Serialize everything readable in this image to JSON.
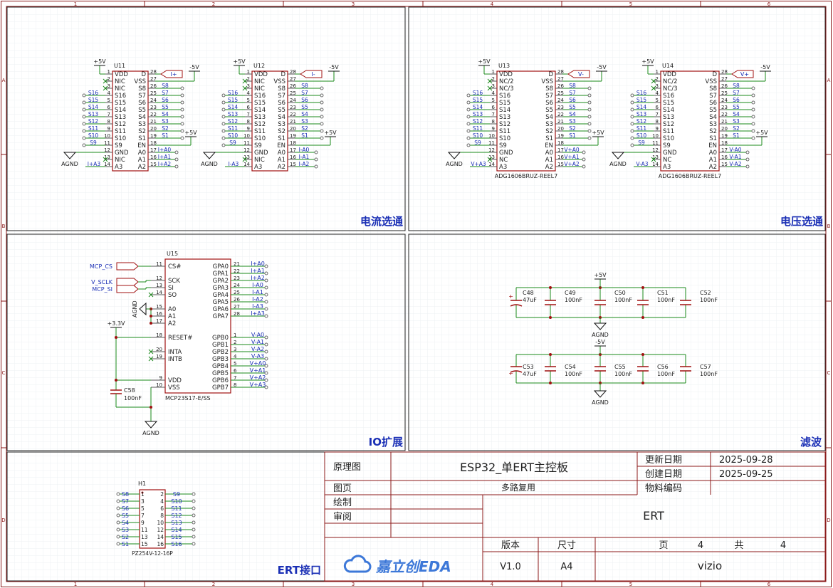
{
  "sheet": {
    "columns": [
      "1",
      "2",
      "3",
      "4",
      "5",
      "6"
    ],
    "rows": [
      "A",
      "B",
      "C",
      "D"
    ],
    "colors": {
      "wire": "#1a8a1a",
      "part": "#a01010",
      "net": "#1a2fb5",
      "border": "#8b1a1a",
      "pin": "#3a3a3a"
    }
  },
  "sections": {
    "current_mux": "电流选通",
    "voltage_mux": "电压选通",
    "io_expand": "IO扩展",
    "filter": "滤波",
    "ert_port": "ERT接口"
  },
  "mux": {
    "u11": {
      "ref": "U11",
      "part": "",
      "top_pwr": "+5V",
      "neg_pwr": "-5V",
      "en_pwr": "+5V",
      "gnd": "AGND",
      "d_net": "I+",
      "a3_net": "I+A3",
      "addr_nets": [
        "I+A0",
        "I+A1",
        "I+A2"
      ],
      "left_pins": [
        [
          "VDD",
          "1"
        ],
        [
          "NIC",
          "2"
        ],
        [
          "NIC",
          "3"
        ],
        [
          "S16",
          "4"
        ],
        [
          "S15",
          "5"
        ],
        [
          "S14",
          "6"
        ],
        [
          "S13",
          "7"
        ],
        [
          "S12",
          "8"
        ],
        [
          "S11",
          "9"
        ],
        [
          "S10",
          "10"
        ],
        [
          "S9",
          "11"
        ],
        [
          "GND",
          "12"
        ],
        [
          "NIC",
          "13"
        ],
        [
          "A3",
          "14"
        ]
      ],
      "right_pins": [
        [
          "D",
          "28"
        ],
        [
          "VSS",
          "27"
        ],
        [
          "S8",
          "26"
        ],
        [
          "S7",
          "25"
        ],
        [
          "S6",
          "24"
        ],
        [
          "S5",
          "23"
        ],
        [
          "S4",
          "22"
        ],
        [
          "S3",
          "21"
        ],
        [
          "S2",
          "20"
        ],
        [
          "S1",
          "19"
        ],
        [
          "EN",
          "18"
        ],
        [
          "A0",
          "17"
        ],
        [
          "A1",
          "16"
        ],
        [
          "A2",
          "15"
        ]
      ]
    },
    "u12": {
      "ref": "U12",
      "part": "",
      "top_pwr": "+5V",
      "neg_pwr": "-5V",
      "en_pwr": "+5V",
      "gnd": "AGND",
      "d_net": "I-",
      "a3_net": "I-A3",
      "addr_nets": [
        "I-A0",
        "I-A1",
        "I-A2"
      ],
      "left_pins": [
        [
          "VDD",
          "1"
        ],
        [
          "NIC",
          "2"
        ],
        [
          "NIC",
          "3"
        ],
        [
          "S16",
          "4"
        ],
        [
          "S15",
          "5"
        ],
        [
          "S14",
          "6"
        ],
        [
          "S13",
          "7"
        ],
        [
          "S12",
          "8"
        ],
        [
          "S11",
          "9"
        ],
        [
          "S10",
          "10"
        ],
        [
          "S9",
          "11"
        ],
        [
          "GND",
          "12"
        ],
        [
          "NIC",
          "13"
        ],
        [
          "A3",
          "14"
        ]
      ],
      "right_pins": [
        [
          "D",
          "28"
        ],
        [
          "VSS",
          "27"
        ],
        [
          "S8",
          "26"
        ],
        [
          "S7",
          "25"
        ],
        [
          "S6",
          "24"
        ],
        [
          "S5",
          "23"
        ],
        [
          "S4",
          "22"
        ],
        [
          "S3",
          "21"
        ],
        [
          "S2",
          "20"
        ],
        [
          "S1",
          "19"
        ],
        [
          "EN",
          "18"
        ],
        [
          "A0",
          "17"
        ],
        [
          "A1",
          "16"
        ],
        [
          "A2",
          "15"
        ]
      ]
    },
    "u13": {
      "ref": "U13",
      "part": "ADG1606BRUZ-REEL7",
      "top_pwr": "+5V",
      "neg_pwr": "-5V",
      "en_pwr": "+5V",
      "gnd": "AGND",
      "d_net": "V-",
      "a3_net": "V+A3",
      "addr_nets": [
        "V+A0",
        "V+A1",
        "V+A2"
      ],
      "left_pins": [
        [
          "VDD",
          "1"
        ],
        [
          "NC/2",
          "2"
        ],
        [
          "NC/3",
          "3"
        ],
        [
          "S16",
          "4"
        ],
        [
          "S15",
          "5"
        ],
        [
          "S14",
          "6"
        ],
        [
          "S13",
          "7"
        ],
        [
          "S12",
          "8"
        ],
        [
          "S11",
          "9"
        ],
        [
          "S10",
          "10"
        ],
        [
          "S9",
          "11"
        ],
        [
          "GND",
          "12"
        ],
        [
          "NC",
          "13"
        ],
        [
          "A3",
          "14"
        ]
      ],
      "right_pins": [
        [
          "D",
          "28"
        ],
        [
          "VSS",
          "27"
        ],
        [
          "S8",
          "26"
        ],
        [
          "S7",
          "25"
        ],
        [
          "S6",
          "24"
        ],
        [
          "S5",
          "23"
        ],
        [
          "S4",
          "22"
        ],
        [
          "S3",
          "21"
        ],
        [
          "S2",
          "20"
        ],
        [
          "S1",
          "19"
        ],
        [
          "EN",
          "18"
        ],
        [
          "A0",
          "17"
        ],
        [
          "A1",
          "16"
        ],
        [
          "A2",
          "15"
        ]
      ]
    },
    "u14": {
      "ref": "U14",
      "part": "ADG1606BRUZ-REEL7",
      "top_pwr": "+5V",
      "neg_pwr": "-5V",
      "en_pwr": "+5V",
      "gnd": "AGND",
      "d_net": "V+",
      "a3_net": "V-A3",
      "addr_nets": [
        "V-A0",
        "V-A1",
        "V-A2"
      ],
      "left_pins": [
        [
          "VDD",
          "1"
        ],
        [
          "NC/2",
          "2"
        ],
        [
          "NC/3",
          "3"
        ],
        [
          "S16",
          "4"
        ],
        [
          "S15",
          "5"
        ],
        [
          "S14",
          "6"
        ],
        [
          "S13",
          "7"
        ],
        [
          "S12",
          "8"
        ],
        [
          "S11",
          "9"
        ],
        [
          "S10",
          "10"
        ],
        [
          "S9",
          "11"
        ],
        [
          "GND",
          "12"
        ],
        [
          "NC",
          "13"
        ],
        [
          "A3",
          "14"
        ]
      ],
      "right_pins": [
        [
          "D",
          "28"
        ],
        [
          "VSS",
          "27"
        ],
        [
          "S8",
          "26"
        ],
        [
          "S7",
          "25"
        ],
        [
          "S6",
          "24"
        ],
        [
          "S5",
          "23"
        ],
        [
          "S4",
          "22"
        ],
        [
          "S3",
          "21"
        ],
        [
          "S2",
          "20"
        ],
        [
          "S1",
          "19"
        ],
        [
          "EN",
          "18"
        ],
        [
          "A0",
          "17"
        ],
        [
          "A1",
          "16"
        ],
        [
          "A2",
          "15"
        ]
      ]
    },
    "s_nets_left": [
      "S16",
      "S15",
      "S14",
      "S13",
      "S12",
      "S11",
      "S10",
      "S9"
    ],
    "s_nets_right": [
      "S8",
      "S7",
      "S6",
      "S5",
      "S4",
      "S3",
      "S2",
      "S1"
    ]
  },
  "io": {
    "ref": "U15",
    "part": "MCP23S17-E/SS",
    "left_pins": [
      [
        "CS#",
        "11"
      ],
      [
        "SCK",
        "12"
      ],
      [
        "SI",
        "13"
      ],
      [
        "SO",
        "14"
      ],
      [
        "A0",
        "15"
      ],
      [
        "A1",
        "16"
      ],
      [
        "A2",
        "17"
      ],
      [
        "RESET#",
        "18"
      ],
      [
        "INTA",
        "20"
      ],
      [
        "INTB",
        "19"
      ],
      [
        "VDD",
        "9"
      ],
      [
        "VSS",
        "10"
      ]
    ],
    "gpa": [
      [
        "GPA0",
        "21",
        "I+A0"
      ],
      [
        "GPA1",
        "22",
        "I+A1"
      ],
      [
        "GPA2",
        "23",
        "I+A2"
      ],
      [
        "GPA3",
        "24",
        "I-A0"
      ],
      [
        "GPA4",
        "25",
        "I-A1"
      ],
      [
        "GPA5",
        "26",
        "I-A2"
      ],
      [
        "GPA6",
        "27",
        "I-A3"
      ],
      [
        "GPA7",
        "28",
        "I+A3"
      ]
    ],
    "gpb": [
      [
        "GPB0",
        "1",
        "V-A0"
      ],
      [
        "GPB1",
        "2",
        "V-A1"
      ],
      [
        "GPB2",
        "3",
        "V-A2"
      ],
      [
        "GPB3",
        "4",
        "V-A3"
      ],
      [
        "GPB4",
        "5",
        "V+A0"
      ],
      [
        "GPB5",
        "6",
        "V+A1"
      ],
      [
        "GPB6",
        "7",
        "V+A2"
      ],
      [
        "GPB7",
        "8",
        "V+A3"
      ]
    ],
    "ports": [
      "MCP_CS",
      "V_SCLK",
      "MCP_SI"
    ],
    "pwr": "+3.3V",
    "gnd": "AGND",
    "cap": {
      "ref": "C58",
      "val": "100nF"
    }
  },
  "filter": {
    "pos_pwr": "+5V",
    "neg_pwr": "-5V",
    "gnd": "AGND",
    "top_caps": [
      [
        "C48",
        "47uF"
      ],
      [
        "C49",
        "100nF"
      ],
      [
        "C50",
        "100nF"
      ],
      [
        "C51",
        "100nF"
      ],
      [
        "C52",
        "100nF"
      ]
    ],
    "bot_caps": [
      [
        "C53",
        "47uF"
      ],
      [
        "C54",
        "100nF"
      ],
      [
        "C55",
        "100nF"
      ],
      [
        "C56",
        "100nF"
      ],
      [
        "C57",
        "100nF"
      ]
    ]
  },
  "header": {
    "ref": "H1",
    "part": "PZ254V-12-16P",
    "left_pins": [
      [
        "S8",
        "1"
      ],
      [
        "S7",
        "3"
      ],
      [
        "S6",
        "5"
      ],
      [
        "S5",
        "7"
      ],
      [
        "S4",
        "9"
      ],
      [
        "S3",
        "11"
      ],
      [
        "S2",
        "13"
      ],
      [
        "S1",
        "15"
      ]
    ],
    "right_pins": [
      [
        "S9",
        "2"
      ],
      [
        "S10",
        "4"
      ],
      [
        "S11",
        "6"
      ],
      [
        "S12",
        "8"
      ],
      [
        "S13",
        "10"
      ],
      [
        "S14",
        "12"
      ],
      [
        "S15",
        "14"
      ],
      [
        "S16",
        "16"
      ]
    ]
  },
  "title_block": {
    "label_schematic": "原理图",
    "title": "ESP32_单ERT主控板",
    "label_updated": "更新日期",
    "updated": "2025-09-28",
    "label_created": "创建日期",
    "created": "2025-09-25",
    "label_page": "图页",
    "page_name": "多路复用",
    "label_partno": "物料编码",
    "label_drawn": "绘制",
    "label_review": "审阅",
    "project": "ERT",
    "label_version": "版本",
    "label_size": "尺寸",
    "label_pg": "页",
    "pg": "4",
    "label_total": "共",
    "total": "4",
    "logo": "嘉立创EDA",
    "version": "V1.0",
    "size": "A4",
    "author": "vizio"
  }
}
